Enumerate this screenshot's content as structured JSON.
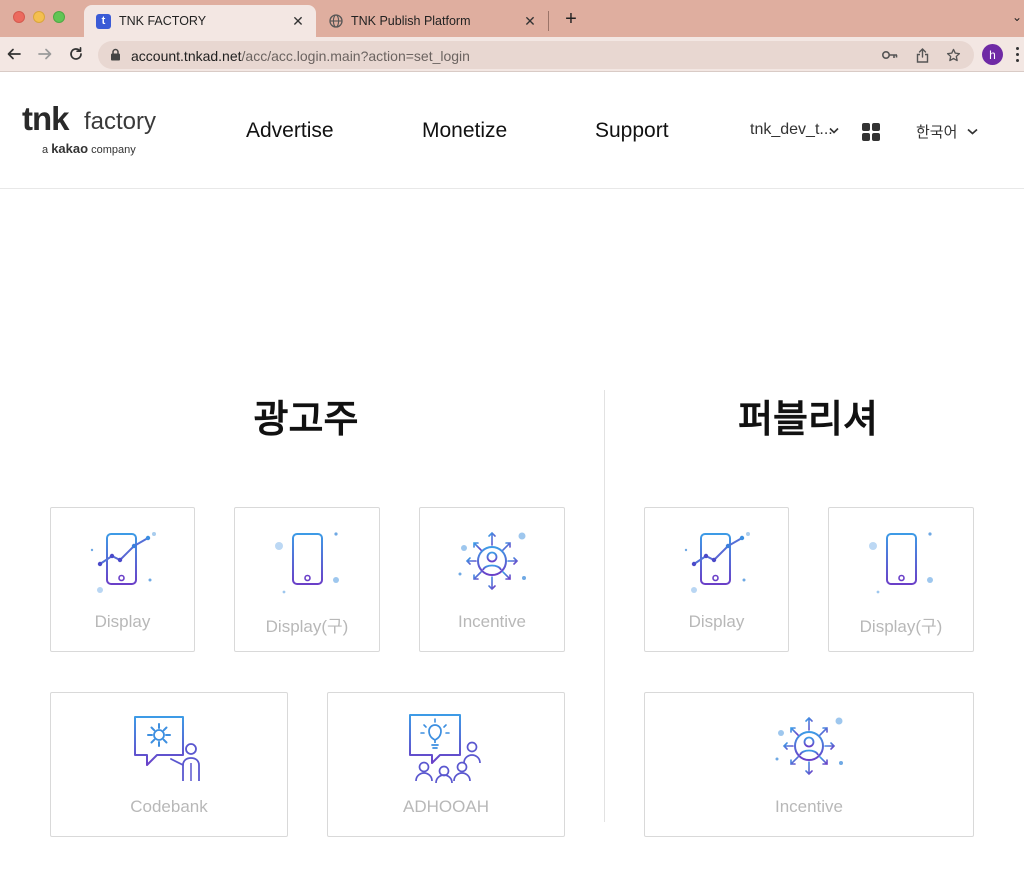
{
  "browser": {
    "tabs": [
      {
        "title": "TNK FACTORY",
        "favicon": "t",
        "active": true
      },
      {
        "title": "TNK Publish Platform",
        "favicon": "globe-icon",
        "active": false
      }
    ],
    "url_host": "account.tnkad.net",
    "url_path": "/acc/acc.login.main?action=set_login",
    "profile_initial": "h"
  },
  "header": {
    "logo_main": "tnk",
    "logo_factory": "factory",
    "logo_sub_prefix": "a",
    "logo_sub_brand": "kakao",
    "logo_sub_suffix": "company",
    "nav": [
      "Advertise",
      "Monetize",
      "Support"
    ],
    "user": "tnk_dev_t...",
    "language": "한국어"
  },
  "advertiser": {
    "title": "광고주",
    "cards": [
      {
        "label": "Display",
        "icon": "phone-chart-icon"
      },
      {
        "label": "Display(구)",
        "icon": "phone-icon"
      },
      {
        "label": "Incentive",
        "icon": "user-arrows-icon"
      },
      {
        "label": "Codebank",
        "icon": "presenter-gear-icon"
      },
      {
        "label": "ADHOOAH",
        "icon": "idea-group-icon"
      }
    ]
  },
  "publisher": {
    "title": "퍼블리셔",
    "cards": [
      {
        "label": "Display",
        "icon": "phone-chart-icon"
      },
      {
        "label": "Display(구)",
        "icon": "phone-icon"
      },
      {
        "label": "Incentive",
        "icon": "user-arrows-icon"
      }
    ]
  },
  "colors": {
    "tabbar": "#dfae9f",
    "toolbar": "#f3e7e3",
    "icon_blue": "#3d8fe0",
    "icon_purple": "#6a4fc9",
    "card_label": "#b8b8b8"
  }
}
